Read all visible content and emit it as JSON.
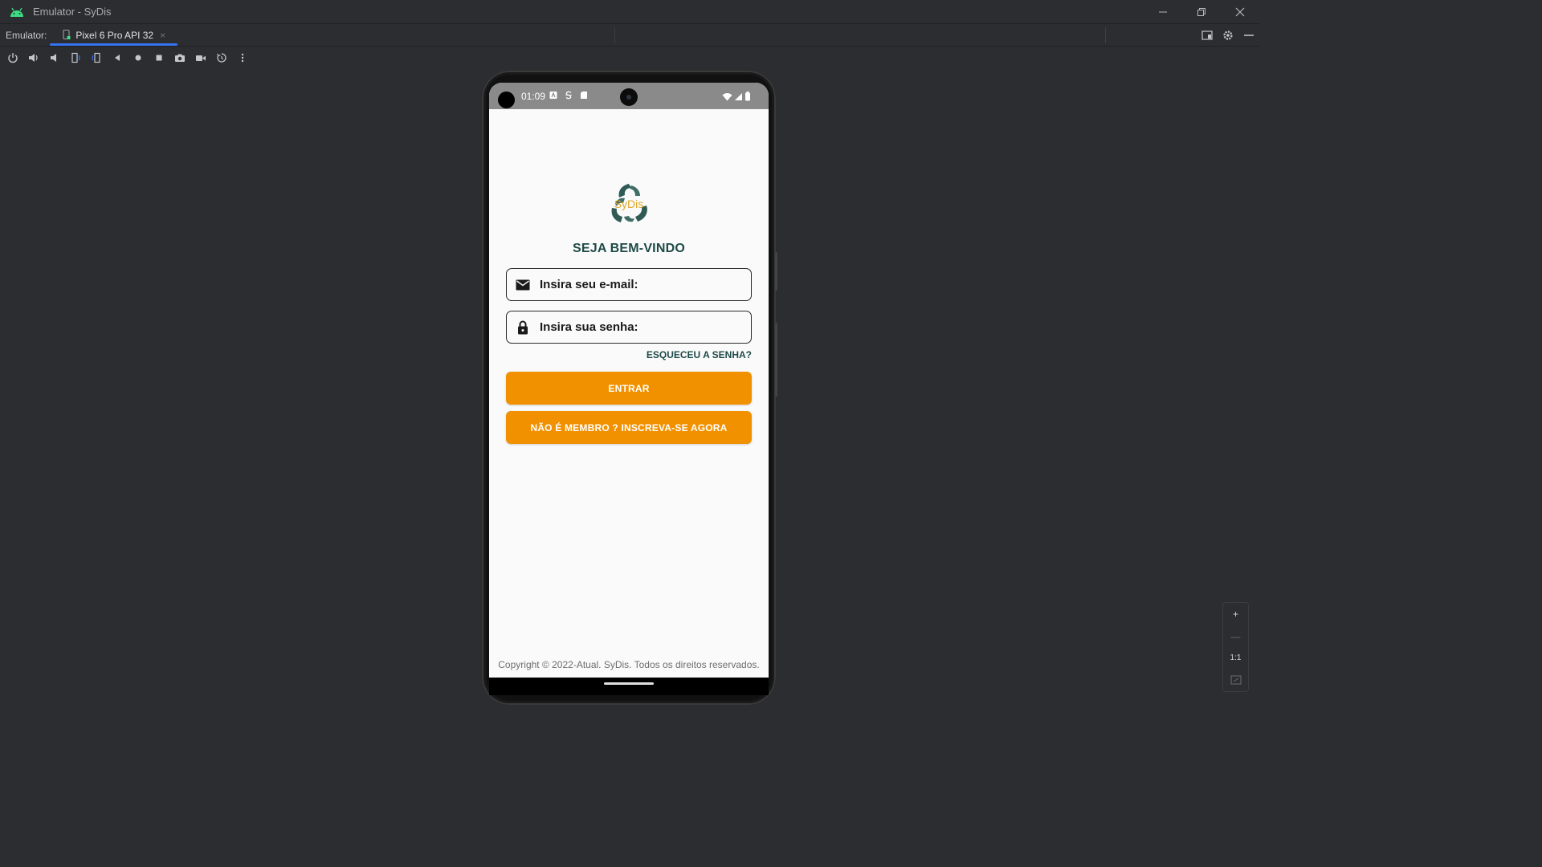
{
  "window": {
    "title": "Emulator - SyDis",
    "controls": [
      "minimize-icon",
      "restore-icon",
      "close-icon"
    ]
  },
  "tabbar": {
    "label": "Emulator:",
    "tab": {
      "name": "Pixel 6 Pro API 32",
      "close": "×"
    }
  },
  "toolbar": {
    "icons": [
      "power-icon",
      "volume-up-icon",
      "volume-down-icon",
      "rotate-left-icon",
      "rotate-right-icon",
      "back-icon",
      "home-icon",
      "overview-icon",
      "screenshot-icon",
      "screen-record-icon",
      "snapshot-icon",
      "more-icon"
    ]
  },
  "device": {
    "statusbar": {
      "time": "01:09",
      "icons": [
        "notification-a-icon",
        "notification-s-icon",
        "sd-card-icon",
        "wifi-icon",
        "signal-icon",
        "battery-icon"
      ]
    },
    "app": {
      "logo_text": "SyDis",
      "welcome": "SEJA BEM-VINDO",
      "email_placeholder": "Insira seu e-mail:",
      "password_placeholder": "Insira sua senha:",
      "forgot": "ESQUECEU A SENHA?",
      "login_button": "ENTRAR",
      "signup_button": "NÃO É MEMBRO ? INSCREVA-SE AGORA",
      "footer": "Copyright © 2022-Atual. SyDis. Todos os direitos reservados."
    }
  },
  "zoom": {
    "in": "+",
    "out": "—",
    "actual": "1:1"
  },
  "colors": {
    "accent": "#f29100",
    "heading": "#1e4a48",
    "ide_bg": "#2b2d30",
    "tab_underline": "#3574f0"
  }
}
